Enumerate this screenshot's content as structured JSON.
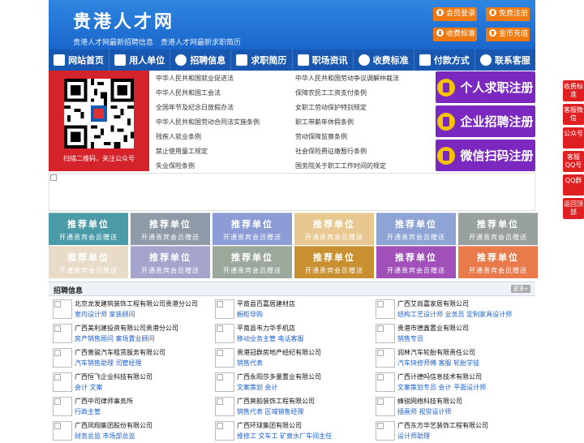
{
  "header": {
    "title": "贵港人才网",
    "subtitle": "贵港人才网最新招聘信息　贵港人才网最新求职简历",
    "buttons": [
      {
        "label": "会员登录",
        "icon": "user-icon"
      },
      {
        "label": "免费注册",
        "icon": "register-icon"
      },
      {
        "label": "收费标准",
        "icon": "price-icon"
      },
      {
        "label": "金币充值",
        "icon": "coin-icon"
      }
    ]
  },
  "nav": [
    {
      "label": "网站首页",
      "icon": "home-icon"
    },
    {
      "label": "用人单位",
      "icon": "building-icon"
    },
    {
      "label": "招聘信息",
      "icon": "person-icon"
    },
    {
      "label": "求职简历",
      "icon": "resume-icon"
    },
    {
      "label": "职场资讯",
      "icon": "news-icon"
    },
    {
      "label": "收费标准",
      "icon": "price-icon"
    },
    {
      "label": "付款方式",
      "icon": "card-icon"
    },
    {
      "label": "联系客服",
      "icon": "phone-icon"
    }
  ],
  "qr": {
    "caption": "扫描二维码，关注公众号"
  },
  "laws": [
    "中华人民共和国就业促进法",
    "中华人民共和国劳动争议调解仲裁法",
    "中华人民共和国工会法",
    "保障农民工工资支付条例",
    "全国年节及纪念日放假办法",
    "女职工劳动保护特别规定",
    "中华人民共和国劳动合同法实施条例",
    "职工带薪年休假条例",
    "残疾人就业条例",
    "劳动保障监察条例",
    "禁止使用童工规定",
    "社会保险费征缴暂行条例",
    "失业保险条例",
    "国务院关于职工工作时间的规定"
  ],
  "register": [
    "个人求职注册",
    "企业招聘注册",
    "微信扫码注册"
  ],
  "recommend": {
    "title": "推荐单位",
    "sub": "开通贵宾会员赠送",
    "colors": [
      "#4a9aa8",
      "#8e9aa8",
      "#8c9cd6",
      "#e8c890",
      "#8ea4d4",
      "#98a0a0",
      "#e8dcc8",
      "#a4a4cc",
      "#9ca89c",
      "#c89030",
      "#a050b8",
      "#e87a4c"
    ]
  },
  "jobs": {
    "title": "招聘信息",
    "more": "更多»",
    "items": [
      {
        "company": "北京龙发建筑装饰工程有限公司贵港分公司",
        "positions": "室内设计师 家装顾问"
      },
      {
        "company": "平南县百嘉居建材店",
        "positions": "橱柜导购"
      },
      {
        "company": "广西艾尚嘉家居有限公司",
        "positions": "结构工艺设计师 业务员 定制家具设计师"
      },
      {
        "company": "广西美利建投资有限公司贵港分公司",
        "positions": "房产销售顾问 案场置业顾问"
      },
      {
        "company": "平南县韦力华手机店",
        "positions": "移动业务主管 电话客服"
      },
      {
        "company": "贵港市德鑫置业有限公司",
        "positions": "销售专员"
      },
      {
        "company": "广西普骏汽车租赁服务有限公司",
        "positions": "汽车销售助理 司管经理"
      },
      {
        "company": "贵港冠群房地产经纪有限公司",
        "positions": "销售代表"
      },
      {
        "company": "润林汽车轮胎有限责任公司",
        "positions": "汽车快修师傅 客服 轮胎学徒"
      },
      {
        "company": "广西恒飞企业科技有限公司",
        "positions": "会计 文案"
      },
      {
        "company": "广西永阳莎多量置业有限公司",
        "positions": "文案策划 会计"
      },
      {
        "company": "广西计德吗信息技术有限公司",
        "positions": "文案策划专员 会计 平面设计师"
      },
      {
        "company": "广西中司律师事务所",
        "positions": "行政主管"
      },
      {
        "company": "广西爽韵装饰工程有限公司",
        "positions": "销售代表 区域销售经理"
      },
      {
        "company": "蜂锐网络科技有限公司",
        "positions": "插画师 视觉设计师"
      },
      {
        "company": "广西凤翔集团股份有限公司",
        "positions": "财务总监 市场部总监"
      },
      {
        "company": "广西环球集团有限公司",
        "positions": "维修工 文车工 矿泉水厂车间主任"
      },
      {
        "company": "广西东方华艺装饰工程有限公司",
        "positions": "设计师助理"
      }
    ]
  },
  "side": [
    "收费标准",
    "客服微信",
    "公众号",
    "客服QQ号",
    "QQ群",
    "返回顶部"
  ]
}
